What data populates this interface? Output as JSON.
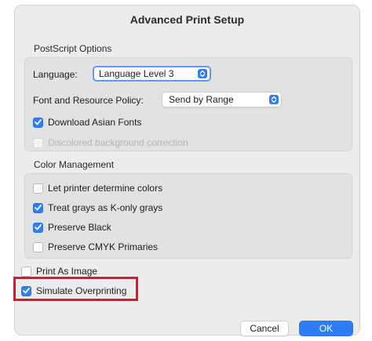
{
  "dialog": {
    "title": "Advanced Print Setup",
    "postscript": {
      "title": "PostScript Options",
      "language_label": "Language:",
      "language_value": "Language Level 3",
      "font_policy_label": "Font and Resource Policy:",
      "font_policy_value": "Send by Range",
      "download_asian_fonts": {
        "label": "Download Asian Fonts",
        "checked": true
      },
      "discolored_background": {
        "label": "Discolored background correction",
        "checked": false,
        "enabled": false
      }
    },
    "color_management": {
      "title": "Color Management",
      "let_printer": {
        "label": "Let printer determine colors",
        "checked": false
      },
      "treat_grays": {
        "label": "Treat grays as K-only grays",
        "checked": true
      },
      "preserve_black": {
        "label": "Preserve Black",
        "checked": true
      },
      "preserve_cmyk": {
        "label": "Preserve CMYK Primaries",
        "checked": false
      }
    },
    "print_as_image": {
      "label": "Print As Image",
      "checked": false
    },
    "simulate_overprinting": {
      "label": "Simulate Overprinting",
      "checked": true
    },
    "buttons": {
      "cancel": "Cancel",
      "ok": "OK"
    }
  },
  "colors": {
    "accent": "#2e7cf6",
    "highlight": "#e3132a"
  }
}
